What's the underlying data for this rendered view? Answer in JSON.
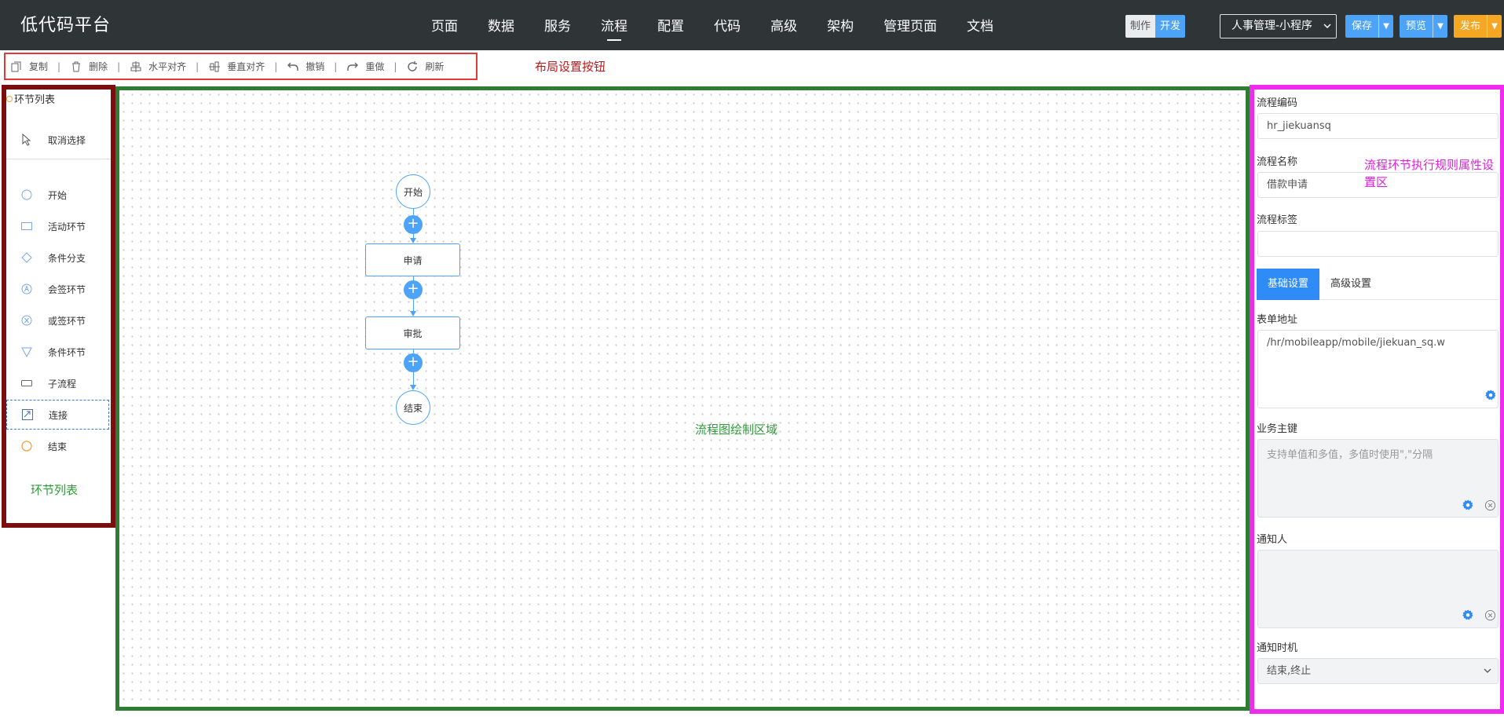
{
  "header": {
    "logo": "低代码平台",
    "nav": [
      "页面",
      "数据",
      "服务",
      "流程",
      "配置",
      "代码",
      "高级",
      "架构",
      "管理页面",
      "文档"
    ],
    "active_nav": "流程",
    "mode_make": "制作",
    "mode_dev": "开发",
    "app_select": "人事管理-小程序",
    "save_label": "保存",
    "preview_label": "预览",
    "publish_label": "发布"
  },
  "toolbar": {
    "copy": "复制",
    "delete": "删除",
    "h_align": "水平对齐",
    "v_align": "垂直对齐",
    "undo": "撤销",
    "redo": "重做",
    "refresh": "刷新",
    "separator": "|",
    "annotation": "布局设置按钮"
  },
  "left_panel": {
    "title": "环节列表",
    "cancel_select": "取消选择",
    "items": [
      "开始",
      "活动环节",
      "条件分支",
      "会签环节",
      "或签环节",
      "条件环节",
      "子流程",
      "连接",
      "结束"
    ],
    "selected_item": "连接",
    "annotation": "环节列表"
  },
  "canvas": {
    "annotation": "流程图绘制区域",
    "nodes": {
      "start": "开始",
      "apply": "申请",
      "approve": "审批",
      "end": "结束"
    },
    "add_symbol": "+"
  },
  "right_panel": {
    "process_code_label": "流程编码",
    "process_code_value": "hr_jiekuansq",
    "process_name_label": "流程名称",
    "process_name_value": "借款申请",
    "process_tag_label": "流程标签",
    "process_tag_value": "",
    "tabs": [
      "基础设置",
      "高级设置"
    ],
    "active_tab": "基础设置",
    "form_url_label": "表单地址",
    "form_url_value": "/hr/mobileapp/mobile/jiekuan_sq.w",
    "business_key_label": "业务主键",
    "business_key_placeholder": "支持单值和多值，多值时使用\",\"分隔",
    "notify_label": "通知人",
    "notify_value": "",
    "notify_time_label": "通知时机",
    "notify_time_value": "结束,终止",
    "annotation": "流程环节执行规则属性设置区"
  },
  "colors": {
    "topbar": "#2f3437",
    "primary": "#4da3f7",
    "publish": "#f5a623",
    "toolbar_border": "#e53935",
    "left_border": "#7b0f0f",
    "canvas_border": "#2e7d32",
    "right_border": "#f02bf0"
  }
}
